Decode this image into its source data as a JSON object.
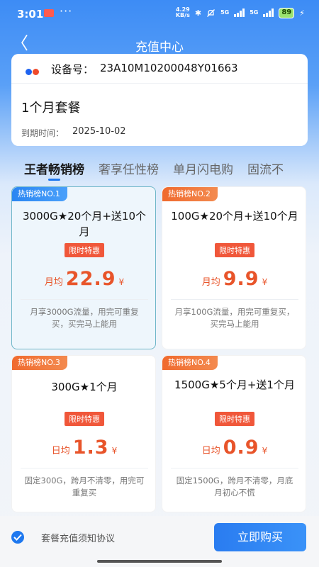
{
  "status_bar": {
    "time": "3:01",
    "dots": "···",
    "net_speed_value": "4.29",
    "net_speed_unit": "KB/s",
    "bluetooth": "✱",
    "sig1_label": "5G",
    "sig2_label": "5G",
    "battery": "89",
    "charging": "⚡"
  },
  "nav": {
    "back": "〈",
    "title": "充值中心"
  },
  "device": {
    "label": "设备号：",
    "id": "23A10M10200048Y01663",
    "logo_colors": [
      "#1e63f0",
      "#f04a2a"
    ]
  },
  "plan": {
    "name": "1个月套餐",
    "expire_label": "到期时间：",
    "expire_date": "2025-10-02"
  },
  "tabs": [
    {
      "label": "王者畅销榜",
      "active": true
    },
    {
      "label": "奢享任性榜",
      "active": false
    },
    {
      "label": "单月闪电购",
      "active": false
    },
    {
      "label": "固流不",
      "active": false
    }
  ],
  "cards": [
    {
      "badge": "热销榜NO.1",
      "name": "3000G★20个月+送10个月",
      "promo": "限时特惠",
      "price_unit": "月均",
      "price": "22.9",
      "currency": "¥",
      "desc": "月享3000G流量，用完可重复买，买完马上能用",
      "selected": true
    },
    {
      "badge": "热销榜NO.2",
      "name": "100G★20个月+送10个月",
      "promo": "限时特惠",
      "price_unit": "月均",
      "price": "9.9",
      "currency": "¥",
      "desc": "月享100G流量，用完可重复买，买完马上能用",
      "selected": false
    },
    {
      "badge": "热销榜NO.3",
      "name": "300G★1个月",
      "promo": "限时特惠",
      "price_unit": "日均",
      "price": "1.3",
      "currency": "¥",
      "desc": "固定300G，跨月不清零，用完可重复买",
      "selected": false
    },
    {
      "badge": "热销榜NO.4",
      "name": "1500G★5个月+送1个月",
      "promo": "限时特惠",
      "price_unit": "日均",
      "price": "0.9",
      "currency": "¥",
      "desc": "固定1500G，跨月不清零，月底月初心不慌",
      "selected": false
    }
  ],
  "bottom": {
    "agreement": "套餐充值须知协议",
    "buy_label": "立即购买",
    "agreement_checked": true
  },
  "colors": {
    "accent_blue": "#1e78ef",
    "promo_red": "#f0573a",
    "price_orange": "#e8542a"
  }
}
